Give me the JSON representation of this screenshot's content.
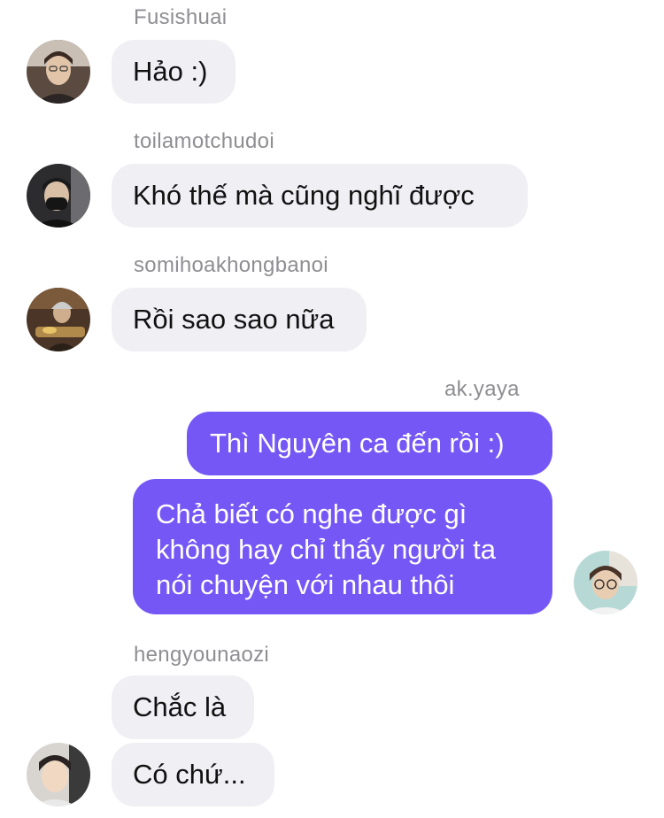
{
  "messages": [
    {
      "sender": "Fusishuai",
      "text": "Hảo :)"
    },
    {
      "sender": "toilamotchudoi",
      "text": "Khó thế mà cũng nghĩ được"
    },
    {
      "sender": "somihoakhongbanoi",
      "text": "Rồi sao sao nữa"
    },
    {
      "sender": "ak.yaya",
      "text": "Thì Nguyên ca đến rồi :)"
    },
    {
      "sender": "ak.yaya",
      "lines": [
        "Chả biết có nghe được gì",
        "không hay chỉ thấy người ta",
        "nói chuyện với nhau thôi"
      ]
    },
    {
      "sender": "hengyounaozi",
      "text": "Chắc là"
    },
    {
      "sender": "hengyounaozi",
      "text": "Có chứ..."
    }
  ],
  "colors": {
    "incoming_bubble": "#efeff4",
    "outgoing_bubble": "#7557f6",
    "sender_label": "#8e8e93"
  },
  "icons": {
    "avatar_1": "user-avatar-photo",
    "avatar_2": "user-avatar-photo",
    "avatar_3": "user-avatar-photo",
    "avatar_4": "user-avatar-photo",
    "avatar_5": "user-avatar-photo"
  }
}
